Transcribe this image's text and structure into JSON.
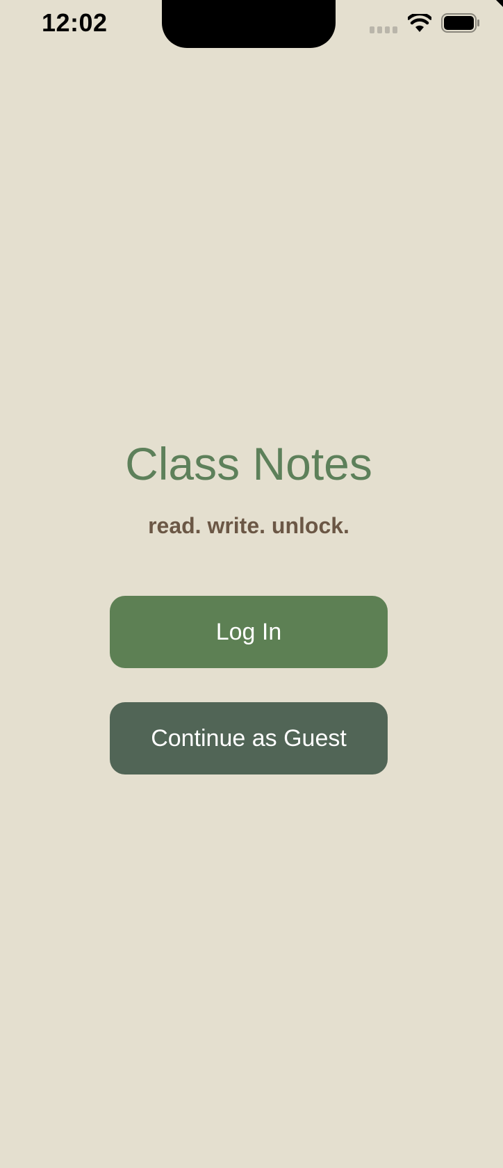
{
  "status_bar": {
    "time": "12:02",
    "icons": [
      "cellular-signal-icon",
      "wifi-icon",
      "battery-icon"
    ]
  },
  "main": {
    "title": "Class Notes",
    "tagline": "read. write. unlock.",
    "login_label": "Log In",
    "guest_label": "Continue as Guest"
  },
  "colors": {
    "background": "#e4dfcf",
    "title": "#5d805a",
    "tagline": "#6b5745",
    "login_button": "#5d8054",
    "guest_button": "#516556"
  }
}
